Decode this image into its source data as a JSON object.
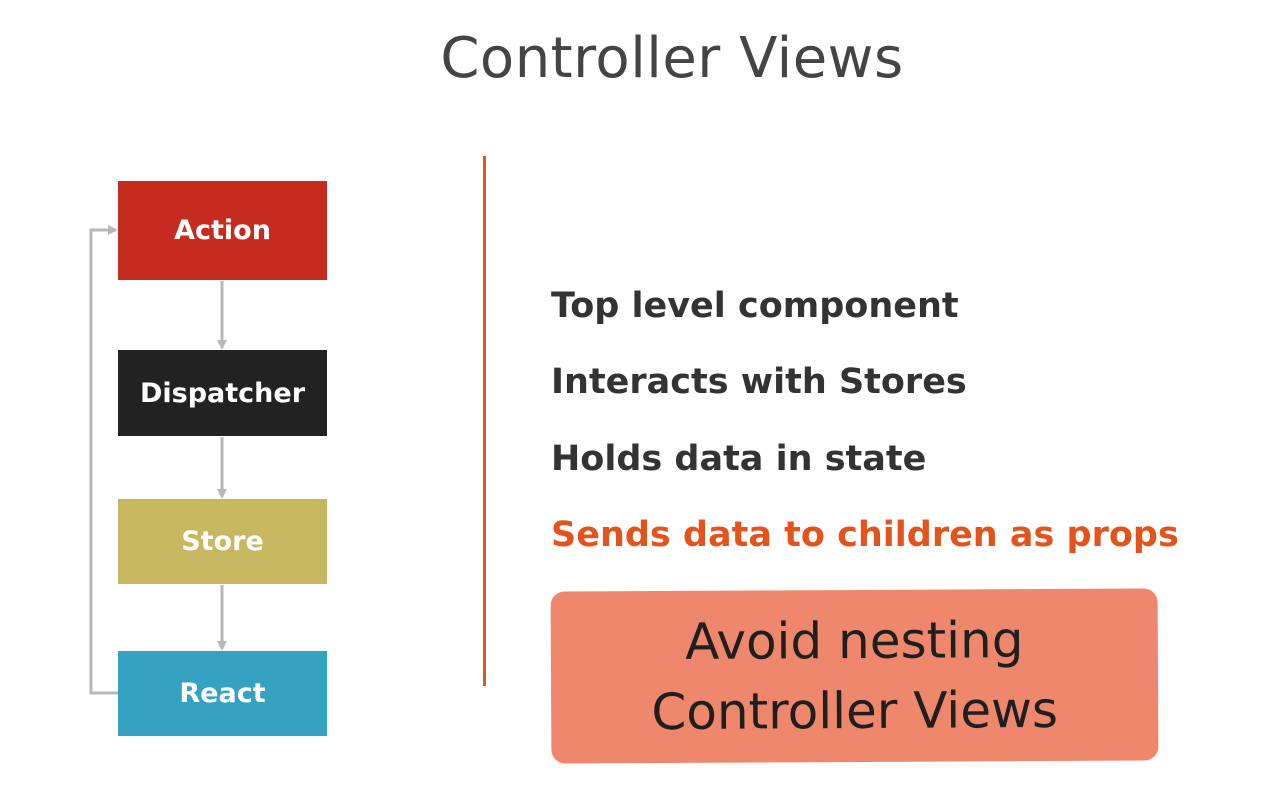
{
  "slide": {
    "title": "Controller Views"
  },
  "flow": {
    "nodes": [
      {
        "label": "Action",
        "color": "#c52b1e"
      },
      {
        "label": "Dispatcher",
        "color": "#222222"
      },
      {
        "label": "Store",
        "color": "#c6b760"
      },
      {
        "label": "React",
        "color": "#35a2c2"
      }
    ],
    "arrow_color": "#b8b8b8"
  },
  "divider_color": "#e0571f",
  "points": {
    "items": [
      {
        "text": "Top level component",
        "color": "#333333"
      },
      {
        "text": "Interacts with Stores",
        "color": "#333333"
      },
      {
        "text": "Holds data in state",
        "color": "#333333"
      },
      {
        "text": "Sends data to children as props",
        "color": "#e3541c"
      }
    ]
  },
  "callout": {
    "line1": "Avoid nesting",
    "line2": "Controller Views",
    "background": "#ee876b"
  }
}
